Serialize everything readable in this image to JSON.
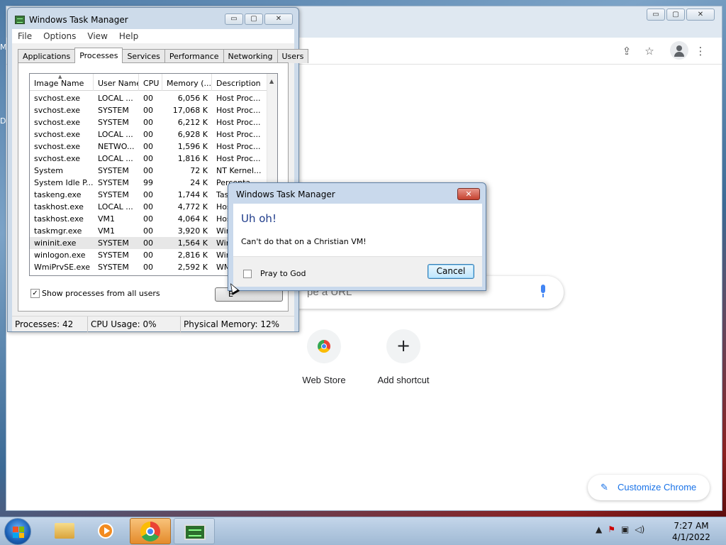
{
  "desktop": {
    "label_top": "M",
    "label_mid": "D"
  },
  "chrome": {
    "caption": {
      "minimize": "▭",
      "maximize": "▢",
      "close": "✕"
    },
    "toolbar": {
      "share": "⇪",
      "bookmark": "☆",
      "menu": "⋮"
    },
    "search_placeholder": "pe a URL",
    "shortcuts": [
      {
        "label": "Web Store"
      },
      {
        "label": "Add shortcut",
        "symbol": "+"
      }
    ],
    "customize_label": "Customize Chrome",
    "customize_icon": "✎"
  },
  "task_manager": {
    "title": "Windows Task Manager",
    "caption": {
      "minimize": "▭",
      "maximize": "▢",
      "close": "✕"
    },
    "menu": [
      "File",
      "Options",
      "View",
      "Help"
    ],
    "tabs": [
      "Applications",
      "Processes",
      "Services",
      "Performance",
      "Networking",
      "Users"
    ],
    "active_tab": "Processes",
    "columns": [
      "Image Name",
      "User Name",
      "CPU",
      "Memory (...",
      "Description"
    ],
    "rows": [
      [
        "svchost.exe",
        "LOCAL ...",
        "00",
        "6,056 K",
        "Host Proc..."
      ],
      [
        "svchost.exe",
        "SYSTEM",
        "00",
        "17,068 K",
        "Host Proc..."
      ],
      [
        "svchost.exe",
        "SYSTEM",
        "00",
        "6,212 K",
        "Host Proc..."
      ],
      [
        "svchost.exe",
        "LOCAL ...",
        "00",
        "6,928 K",
        "Host Proc..."
      ],
      [
        "svchost.exe",
        "NETWO...",
        "00",
        "1,596 K",
        "Host Proc..."
      ],
      [
        "svchost.exe",
        "LOCAL ...",
        "00",
        "1,816 K",
        "Host Proc..."
      ],
      [
        "System",
        "SYSTEM",
        "00",
        "72 K",
        "NT Kernel..."
      ],
      [
        "System Idle P...",
        "SYSTEM",
        "99",
        "24 K",
        "Percenta..."
      ],
      [
        "taskeng.exe",
        "SYSTEM",
        "00",
        "1,744 K",
        "Tas"
      ],
      [
        "taskhost.exe",
        "LOCAL ...",
        "00",
        "4,772 K",
        "Hos"
      ],
      [
        "taskhost.exe",
        "VM1",
        "00",
        "4,064 K",
        "Hos"
      ],
      [
        "taskmgr.exe",
        "VM1",
        "00",
        "3,920 K",
        "Win"
      ],
      [
        "wininit.exe",
        "SYSTEM",
        "00",
        "1,564 K",
        "Win"
      ],
      [
        "winlogon.exe",
        "SYSTEM",
        "00",
        "2,816 K",
        "Win"
      ],
      [
        "WmiPrvSE.exe",
        "SYSTEM",
        "00",
        "2,592 K",
        "WM"
      ]
    ],
    "selected_row": 12,
    "show_all_label": "Show processes from all users",
    "show_all_checked": "✓",
    "end_process_label": "E",
    "status": {
      "processes": "Processes: 42",
      "cpu": "CPU Usage: 0%",
      "memory": "Physical Memory: 12%"
    }
  },
  "dialog": {
    "title": "Windows Task Manager",
    "close": "✕",
    "heading": "Uh oh!",
    "message": "Can't do that on a Christian VM!",
    "checkbox_label": "Pray to God",
    "cancel_label": "Cancel"
  },
  "taskbar": {
    "tray_icons": [
      "▲",
      "⚑",
      "▣",
      "◁)"
    ],
    "time": "7:27 AM",
    "date": "4/1/2022"
  }
}
